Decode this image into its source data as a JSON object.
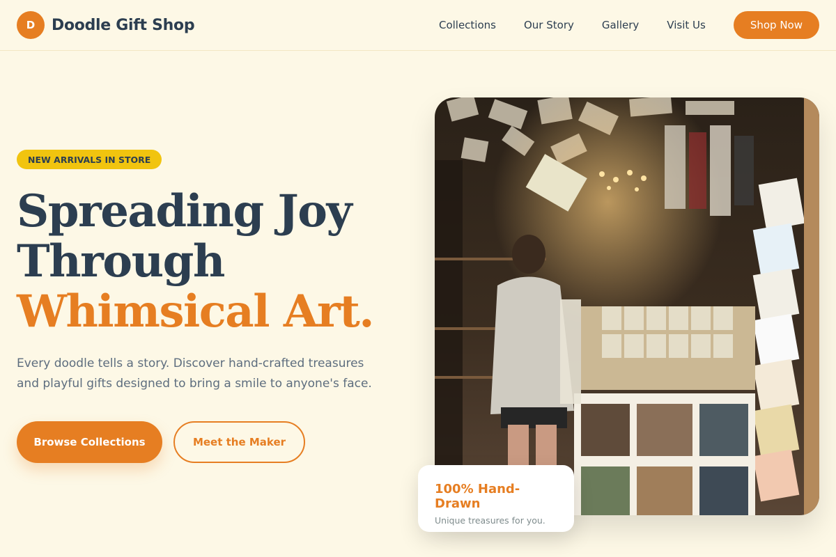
{
  "brand": {
    "logo_letter": "D",
    "name": "Doodle Gift Shop",
    "accent_color": "#e67e22",
    "dark_color": "#2c3e50",
    "badge_color": "#f1c40f",
    "background_color": "#fdf8e6"
  },
  "nav": {
    "links": [
      "Collections",
      "Our Story",
      "Gallery",
      "Visit Us"
    ],
    "cta": "Shop Now"
  },
  "hero": {
    "badge": "NEW ARRIVALS IN STORE",
    "title_line1": "Spreading Joy",
    "title_line2": "Through",
    "title_line3": "Whimsical Art.",
    "subtitle": "Every doodle tells a story. Discover hand-crafted treasures and playful gifts designed to bring a smile to anyone's face.",
    "primary_button": "Browse Collections",
    "secondary_button": "Meet the Maker",
    "image_subject": "photo of a woman browsing greeting cards and books inside a cluttered gift shop"
  },
  "float_card": {
    "title": "100% Hand-Drawn",
    "subtitle": "Unique treasures for you."
  }
}
